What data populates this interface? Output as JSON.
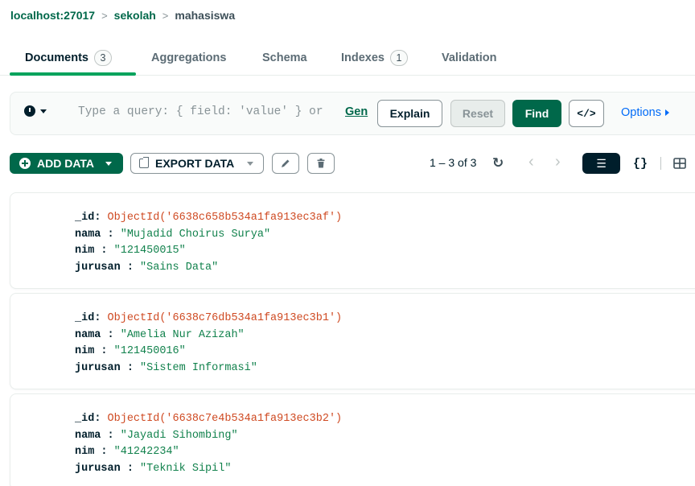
{
  "breadcrumb": {
    "host": "localhost:27017",
    "database": "sekolah",
    "collection": "mahasiswa"
  },
  "tabs": [
    {
      "label": "Documents",
      "count": "3",
      "active": true
    },
    {
      "label": "Aggregations"
    },
    {
      "label": "Schema"
    },
    {
      "label": "Indexes",
      "count": "1"
    },
    {
      "label": "Validation"
    }
  ],
  "query_bar": {
    "placeholder": "Type a query: { field: 'value' } or",
    "generate_link": "Gen",
    "explain": "Explain",
    "reset": "Reset",
    "find": "Find",
    "code": "</>",
    "options": "Options"
  },
  "toolbar": {
    "add_data": "ADD DATA",
    "export_data": "EXPORT DATA",
    "pagination": "1 – 3 of 3"
  },
  "documents": [
    {
      "id_label": "_id",
      "id_value": "ObjectId('6638c658b534a1fa913ec3af')",
      "nama": "\"Mujadid Choirus Surya\"",
      "nim": "\"121450015\"",
      "jurusan": "\"Sains Data\""
    },
    {
      "id_label": "_id",
      "id_value": "ObjectId('6638c76db534a1fa913ec3b1')",
      "nama": "\"Amelia Nur Azizah\"",
      "nim": "\"121450016\"",
      "jurusan": "\"Sistem Informasi\""
    },
    {
      "id_label": "_id",
      "id_value": "ObjectId('6638c7e4b534a1fa913ec3b2')",
      "nama": "\"Jayadi Sihombing\"",
      "nim": "\"41242234\"",
      "jurusan": "\"Teknik Sipil\""
    }
  ],
  "field_labels": {
    "id": "_id",
    "nama": "nama",
    "nim": "nim",
    "jurusan": "jurusan"
  },
  "colors": {
    "accent_green": "#00684a",
    "tab_underline": "#00a35c",
    "object_id": "#cf4a22",
    "string_value": "#12824d",
    "link_blue": "#016bf8"
  },
  "icons": [
    "chevron-right-icon",
    "clock-icon",
    "caret-down-icon",
    "code-icon",
    "caret-right-icon",
    "plus-circle-icon",
    "export-icon",
    "pencil-icon",
    "trash-icon",
    "refresh-icon",
    "chevron-left-icon",
    "list-view-icon",
    "json-view-icon",
    "table-view-icon"
  ]
}
